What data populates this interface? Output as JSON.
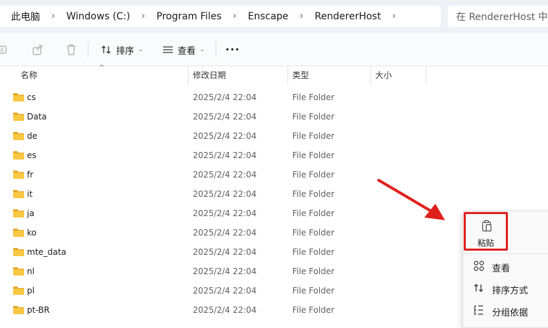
{
  "breadcrumb": {
    "items": [
      "此电脑",
      "Windows (C:)",
      "Program Files",
      "Enscape",
      "RendererHost"
    ],
    "separator": "›"
  },
  "search": {
    "placeholder": "在 RendererHost 中搜"
  },
  "toolbar": {
    "sort_label": "排序",
    "view_label": "查看",
    "more_label": "···"
  },
  "columns": {
    "name": "名称",
    "date": "修改日期",
    "type": "类型",
    "size": "大小"
  },
  "files": [
    {
      "name": "cs",
      "date": "2025/2/4 22:04",
      "type": "File Folder"
    },
    {
      "name": "Data",
      "date": "2025/2/4 22:04",
      "type": "File Folder"
    },
    {
      "name": "de",
      "date": "2025/2/4 22:04",
      "type": "File Folder"
    },
    {
      "name": "es",
      "date": "2025/2/4 22:04",
      "type": "File Folder"
    },
    {
      "name": "fr",
      "date": "2025/2/4 22:04",
      "type": "File Folder"
    },
    {
      "name": "it",
      "date": "2025/2/4 22:04",
      "type": "File Folder"
    },
    {
      "name": "ja",
      "date": "2025/2/4 22:04",
      "type": "File Folder"
    },
    {
      "name": "ko",
      "date": "2025/2/4 22:04",
      "type": "File Folder"
    },
    {
      "name": "mte_data",
      "date": "2025/2/4 22:04",
      "type": "File Folder"
    },
    {
      "name": "nl",
      "date": "2025/2/4 22:04",
      "type": "File Folder"
    },
    {
      "name": "pl",
      "date": "2025/2/4 22:04",
      "type": "File Folder"
    },
    {
      "name": "pt-BR",
      "date": "2025/2/4 22:04",
      "type": "File Folder"
    }
  ],
  "context_menu": {
    "paste_label": "粘贴",
    "items": [
      {
        "label": "查看",
        "icon": "grid-icon"
      },
      {
        "label": "排序方式",
        "icon": "sort-icon"
      },
      {
        "label": "分组依据",
        "icon": "group-icon"
      }
    ]
  },
  "colors": {
    "highlight": "#e0201d",
    "folder": "#f8c744"
  }
}
